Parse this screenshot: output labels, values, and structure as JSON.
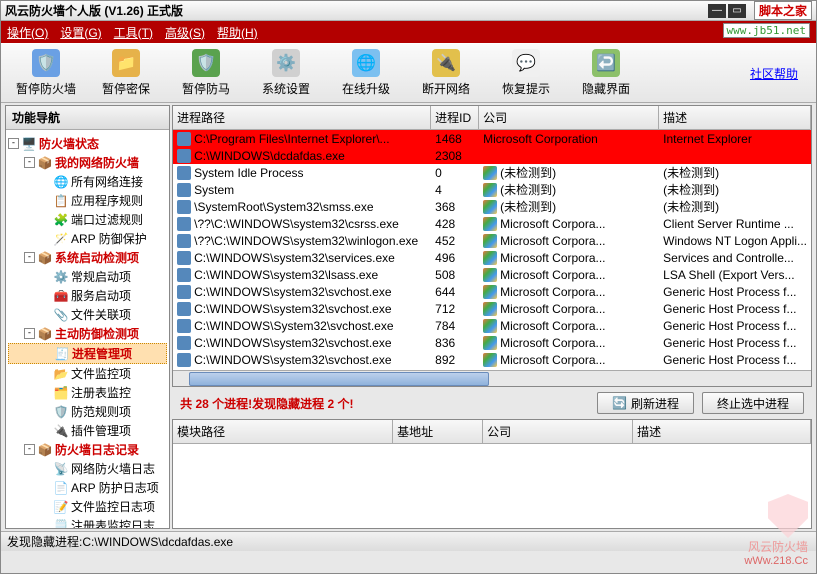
{
  "window": {
    "title": "风云防火墙个人版 (V1.26) 正式版",
    "script_home": "脚本之家",
    "url_hint": "www.jb51.net"
  },
  "menu": {
    "operate": "操作(O)",
    "settings": "设置(G)",
    "tools": "工具(T)",
    "advanced": "高级(S)",
    "help": "帮助(H)"
  },
  "toolbar": {
    "items": [
      {
        "label": "暂停防火墙",
        "icon": "🛡️",
        "bg": "#6aa0e4"
      },
      {
        "label": "暂停密保",
        "icon": "📁",
        "bg": "#e6b24a"
      },
      {
        "label": "暂停防马",
        "icon": "🛡️",
        "bg": "#5aa24e"
      },
      {
        "label": "系统设置",
        "icon": "⚙️",
        "bg": "#d0d0d0"
      },
      {
        "label": "在线升级",
        "icon": "🌐",
        "bg": "#7cc0f0"
      },
      {
        "label": "断开网络",
        "icon": "🔌",
        "bg": "#e2c04c"
      },
      {
        "label": "恢复提示",
        "icon": "💬",
        "bg": "#f0f0f0"
      },
      {
        "label": "隐藏界面",
        "icon": "↩️",
        "bg": "#8cc06a"
      }
    ],
    "community_help": "社区帮助"
  },
  "nav": {
    "title": "功能导航",
    "root": "防火墙状态",
    "groups": [
      {
        "label": "我的网络防火墙",
        "red": true,
        "children": [
          {
            "label": "所有网络连接",
            "icon": "🌐"
          },
          {
            "label": "应用程序规则",
            "icon": "📋"
          },
          {
            "label": "端口过滤规则",
            "icon": "🧩"
          },
          {
            "label": "ARP 防御保护",
            "icon": "🪄"
          }
        ]
      },
      {
        "label": "系统启动检测项",
        "red": true,
        "children": [
          {
            "label": "常规启动项",
            "icon": "⚙️"
          },
          {
            "label": "服务启动项",
            "icon": "🧰"
          },
          {
            "label": "文件关联项",
            "icon": "📎"
          }
        ]
      },
      {
        "label": "主动防御检测项",
        "red": true,
        "children": [
          {
            "label": "进程管理项",
            "icon": "🧾",
            "selected": true
          },
          {
            "label": "文件监控项",
            "icon": "📂"
          },
          {
            "label": "注册表监控",
            "icon": "🗂️"
          },
          {
            "label": "防范规则项",
            "icon": "🛡️"
          },
          {
            "label": "插件管理项",
            "icon": "🔌"
          }
        ]
      },
      {
        "label": "防火墙日志记录",
        "red": true,
        "children": [
          {
            "label": "网络防火墙日志",
            "icon": "📡"
          },
          {
            "label": "ARP 防护日志项",
            "icon": "📄"
          },
          {
            "label": "文件监控日志项",
            "icon": "📝"
          },
          {
            "label": "注册表监控日志",
            "icon": "🗒️"
          }
        ]
      }
    ]
  },
  "table": {
    "headers": {
      "path": "进程路径",
      "pid": "进程ID",
      "company": "公司",
      "desc": "描述"
    },
    "rows": [
      {
        "path": "C:\\Program Files\\Internet Explorer\\...",
        "pid": "1468",
        "company": "Microsoft Corporation",
        "desc": "Internet Explorer",
        "hi": true,
        "hasWin": false
      },
      {
        "path": "C:\\WINDOWS\\dcdafdas.exe",
        "pid": "2308",
        "company": "",
        "desc": "",
        "hi": true,
        "hasWin": false
      },
      {
        "path": "System Idle Process",
        "pid": "0",
        "company": "(未检测到)",
        "desc": "(未检测到)",
        "hasWin": true
      },
      {
        "path": "System",
        "pid": "4",
        "company": "(未检测到)",
        "desc": "(未检测到)",
        "hasWin": true
      },
      {
        "path": "\\SystemRoot\\System32\\smss.exe",
        "pid": "368",
        "company": "(未检测到)",
        "desc": "(未检测到)",
        "hasWin": true
      },
      {
        "path": "\\??\\C:\\WINDOWS\\system32\\csrss.exe",
        "pid": "428",
        "company": "Microsoft Corpora...",
        "desc": "Client Server Runtime ...",
        "hasWin": true
      },
      {
        "path": "\\??\\C:\\WINDOWS\\system32\\winlogon.exe",
        "pid": "452",
        "company": "Microsoft Corpora...",
        "desc": "Windows NT Logon Appli...",
        "hasWin": true
      },
      {
        "path": "C:\\WINDOWS\\system32\\services.exe",
        "pid": "496",
        "company": "Microsoft Corpora...",
        "desc": "Services and Controlle...",
        "hasWin": true
      },
      {
        "path": "C:\\WINDOWS\\system32\\lsass.exe",
        "pid": "508",
        "company": "Microsoft Corpora...",
        "desc": "LSA Shell (Export Vers...",
        "hasWin": true
      },
      {
        "path": "C:\\WINDOWS\\system32\\svchost.exe",
        "pid": "644",
        "company": "Microsoft Corpora...",
        "desc": "Generic Host Process f...",
        "hasWin": true
      },
      {
        "path": "C:\\WINDOWS\\system32\\svchost.exe",
        "pid": "712",
        "company": "Microsoft Corpora...",
        "desc": "Generic Host Process f...",
        "hasWin": true
      },
      {
        "path": "C:\\WINDOWS\\System32\\svchost.exe",
        "pid": "784",
        "company": "Microsoft Corpora...",
        "desc": "Generic Host Process f...",
        "hasWin": true
      },
      {
        "path": "C:\\WINDOWS\\system32\\svchost.exe",
        "pid": "836",
        "company": "Microsoft Corpora...",
        "desc": "Generic Host Process f...",
        "hasWin": true
      },
      {
        "path": "C:\\WINDOWS\\system32\\svchost.exe",
        "pid": "892",
        "company": "Microsoft Corpora...",
        "desc": "Generic Host Process f...",
        "hasWin": true
      }
    ]
  },
  "status": {
    "summary": "共 28 个进程!发现隐藏进程 2 个!",
    "refresh": "刷新进程",
    "terminate": "终止选中进程"
  },
  "modules": {
    "headers": {
      "path": "模块路径",
      "base": "基地址",
      "company": "公司",
      "desc": "描述"
    }
  },
  "footer": {
    "text": "发现隐藏进程:C:\\WINDOWS\\dcdafdas.exe"
  },
  "watermark": {
    "name": "风云防火墙",
    "url": "wWw.218.Cc"
  }
}
